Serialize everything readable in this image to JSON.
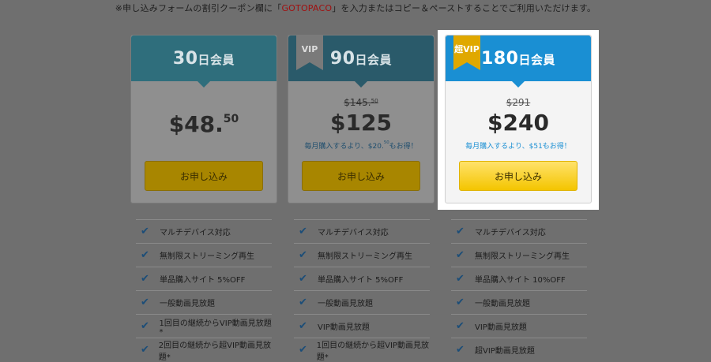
{
  "notice": {
    "before": "※申し込みフォームの割引クーポン欄に「",
    "code": "GOTOPACO",
    "after": "」を入力またはコピー＆ペーストすることでご利用いただけます。"
  },
  "plans": [
    {
      "days": "30",
      "unit": "日会員",
      "ribbon": "",
      "old_price": "",
      "price_main": "$48.",
      "price_cents": "50",
      "note_main": "",
      "button": "お申し込み"
    },
    {
      "days": "90",
      "unit": "日会員",
      "ribbon": "VIP",
      "old_price_main": "$145.",
      "old_price_cents": "50",
      "price_main": "$125",
      "price_cents": "",
      "note_before": "毎月購入するより、$20.",
      "note_cents": "50",
      "note_after": "もお得！",
      "button": "お申し込み"
    },
    {
      "days": "180",
      "unit": "日会員",
      "ribbon": "超VIP",
      "old_price_main": "$291",
      "price_main": "$240",
      "price_cents": "",
      "note_before": "毎月購入するより、$51もお得！",
      "button": "お申し込み"
    }
  ],
  "features": [
    [
      "マルチデバイス対応",
      "無制限ストリーミング再生",
      "単品購入サイト 5%OFF",
      "一般動画見放題",
      "1回目の継続からVIP動画見放題*",
      "2回目の継続から超VIP動画見放題*"
    ],
    [
      "マルチデバイス対応",
      "無制限ストリーミング再生",
      "単品購入サイト 5%OFF",
      "一般動画見放題",
      "VIP動画見放題",
      "1回目の継続から超VIP動画見放題*"
    ],
    [
      "マルチデバイス対応",
      "無制限ストリーミング再生",
      "単品購入サイト 10%OFF",
      "一般動画見放題",
      "VIP動画見放題",
      "超VIP動画見放題"
    ]
  ],
  "colors": {
    "overlay": "#6f6f6f",
    "highlight_header": "#1a8fd3",
    "button_gold": "#f4c500",
    "ribbon_gold": "#e0a800"
  }
}
